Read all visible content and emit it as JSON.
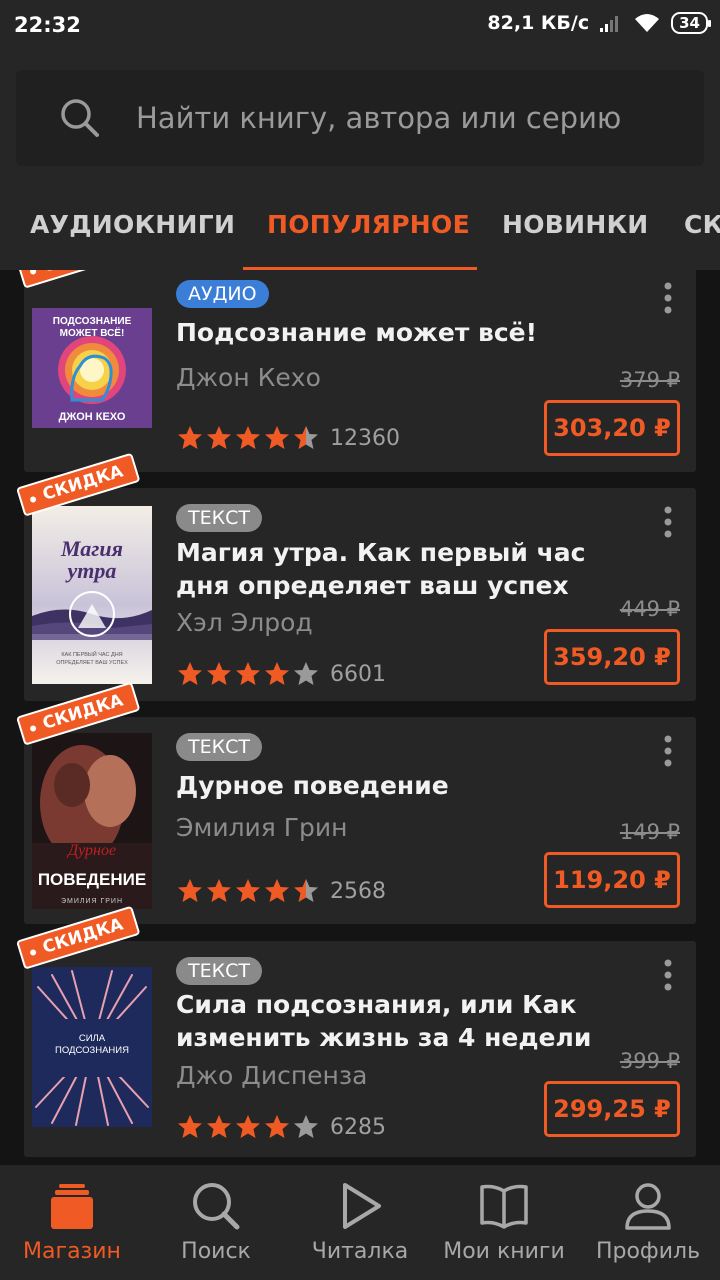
{
  "status_bar": {
    "time": "22:32",
    "speed": "82,1 КБ/с",
    "battery": "34"
  },
  "search": {
    "placeholder": "Найти книгу, автора или серию"
  },
  "tabs": [
    {
      "label": "АУДИОКНИГИ",
      "active": false
    },
    {
      "label": "ПОПУЛЯРНОЕ",
      "active": true
    },
    {
      "label": "НОВИНКИ",
      "active": false
    },
    {
      "label": "СК",
      "active": false
    }
  ],
  "badge_label": "СКИДКА",
  "books": [
    {
      "format": "АУДИО",
      "title": "Подсознание может всё!",
      "author": "Джон Кехо",
      "rating": 4.5,
      "rating_count": "12360",
      "old_price": "379 ₽",
      "price": "303,20 ₽",
      "cover_text_top": "ПОДСОЗНАНИЕ МОЖЕТ ВСЁ!",
      "cover_text_bottom": "ДЖОН КЕХО"
    },
    {
      "format": "ТЕКСТ",
      "title": "Магия утра. Как первый час дня определяет ваш успех",
      "author": "Хэл Элрод",
      "rating": 4,
      "rating_count": "6601",
      "old_price": "449 ₽",
      "price": "359,20 ₽",
      "cover_text_top": "Магия утра",
      "cover_text_bottom": ""
    },
    {
      "format": "ТЕКСТ",
      "title": "Дурное поведение",
      "author": "Эмилия Грин",
      "rating": 4.5,
      "rating_count": "2568",
      "old_price": "149 ₽",
      "price": "119,20 ₽",
      "cover_text_top": "ПОВЕДЕНИЕ",
      "cover_text_bottom": "ЭМИЛИЯ ГРИН"
    },
    {
      "format": "ТЕКСТ",
      "title": "Сила подсознания, или Как изменить жизнь за 4 недели",
      "author": "Джо Диспенза",
      "rating": 4,
      "rating_count": "6285",
      "old_price": "399 ₽",
      "price": "299,25 ₽",
      "cover_text_top": "СИЛА ПОДСОЗНАНИЯ",
      "cover_text_bottom": ""
    }
  ],
  "bottom_nav": [
    {
      "label": "Магазин",
      "icon": "store-icon",
      "active": true
    },
    {
      "label": "Поиск",
      "icon": "search-icon",
      "active": false
    },
    {
      "label": "Читалка",
      "icon": "play-icon",
      "active": false
    },
    {
      "label": "Мои книги",
      "icon": "book-icon",
      "active": false
    },
    {
      "label": "Профиль",
      "icon": "profile-icon",
      "active": false
    }
  ],
  "colors": {
    "accent": "#f05a24",
    "audio_chip": "#3a7ed8",
    "text_chip": "#8a8a8a",
    "card_bg": "#262626"
  }
}
